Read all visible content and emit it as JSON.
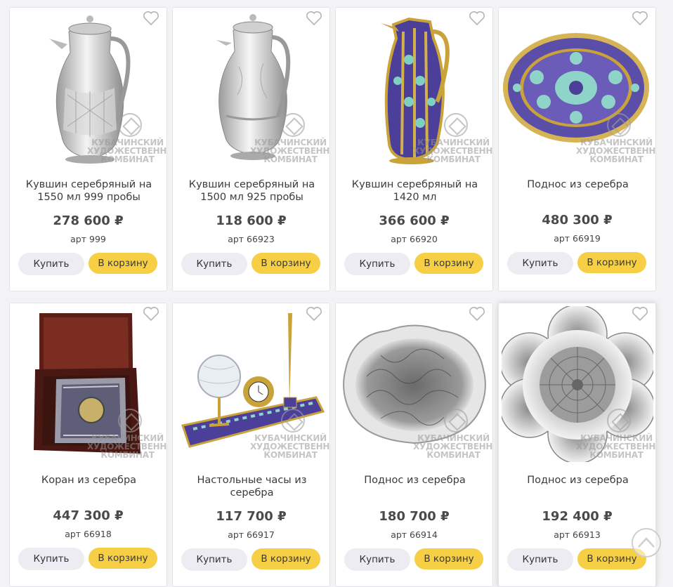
{
  "watermark": [
    "КУБАЧИНСКИЙ",
    "ХУДОЖЕСТВЕННЫЙ",
    "КОМБИНАТ"
  ],
  "buttons": {
    "buy_label": "Купить",
    "cart_label": "В корзину"
  },
  "products": [
    {
      "title": "Кувшин серебряный на 1550 мл 999 пробы",
      "price": "278 600 ₽",
      "art": "арт 999",
      "image": "silver-jug"
    },
    {
      "title": "Кувшин серебряный на 1500 мл 925 пробы",
      "price": "118 600 ₽",
      "art": "арт 66923",
      "image": "silver-jug"
    },
    {
      "title": "Кувшин серебряный на 1420 мл",
      "price": "366 600 ₽",
      "art": "арт 66920",
      "image": "enamel-jug"
    },
    {
      "title": "Поднос из серебра",
      "price": "480 300 ₽",
      "art": "арт 66919",
      "image": "enamel-tray"
    },
    {
      "title": "Коран из серебра",
      "price": "447 300 ₽",
      "art": "арт 66918",
      "image": "quran-box"
    },
    {
      "title": "Настольные часы из серебра",
      "price": "117 700 ₽",
      "art": "арт 66917",
      "image": "desk-clock"
    },
    {
      "title": "Поднос из серебра",
      "price": "180 700 ₽",
      "art": "арт 66914",
      "image": "silver-tray-oval"
    },
    {
      "title": "Поднос из серебра",
      "price": "192 400 ₽",
      "art": "арт 66913",
      "image": "silver-tray-flower"
    }
  ],
  "icons": {
    "favorite": "heart-outline-icon",
    "scroll_top": "chevron-up-icon"
  },
  "colors": {
    "cart_button": "#f6cf45",
    "buy_button": "#ececf2",
    "background": "#f3f3f5"
  }
}
